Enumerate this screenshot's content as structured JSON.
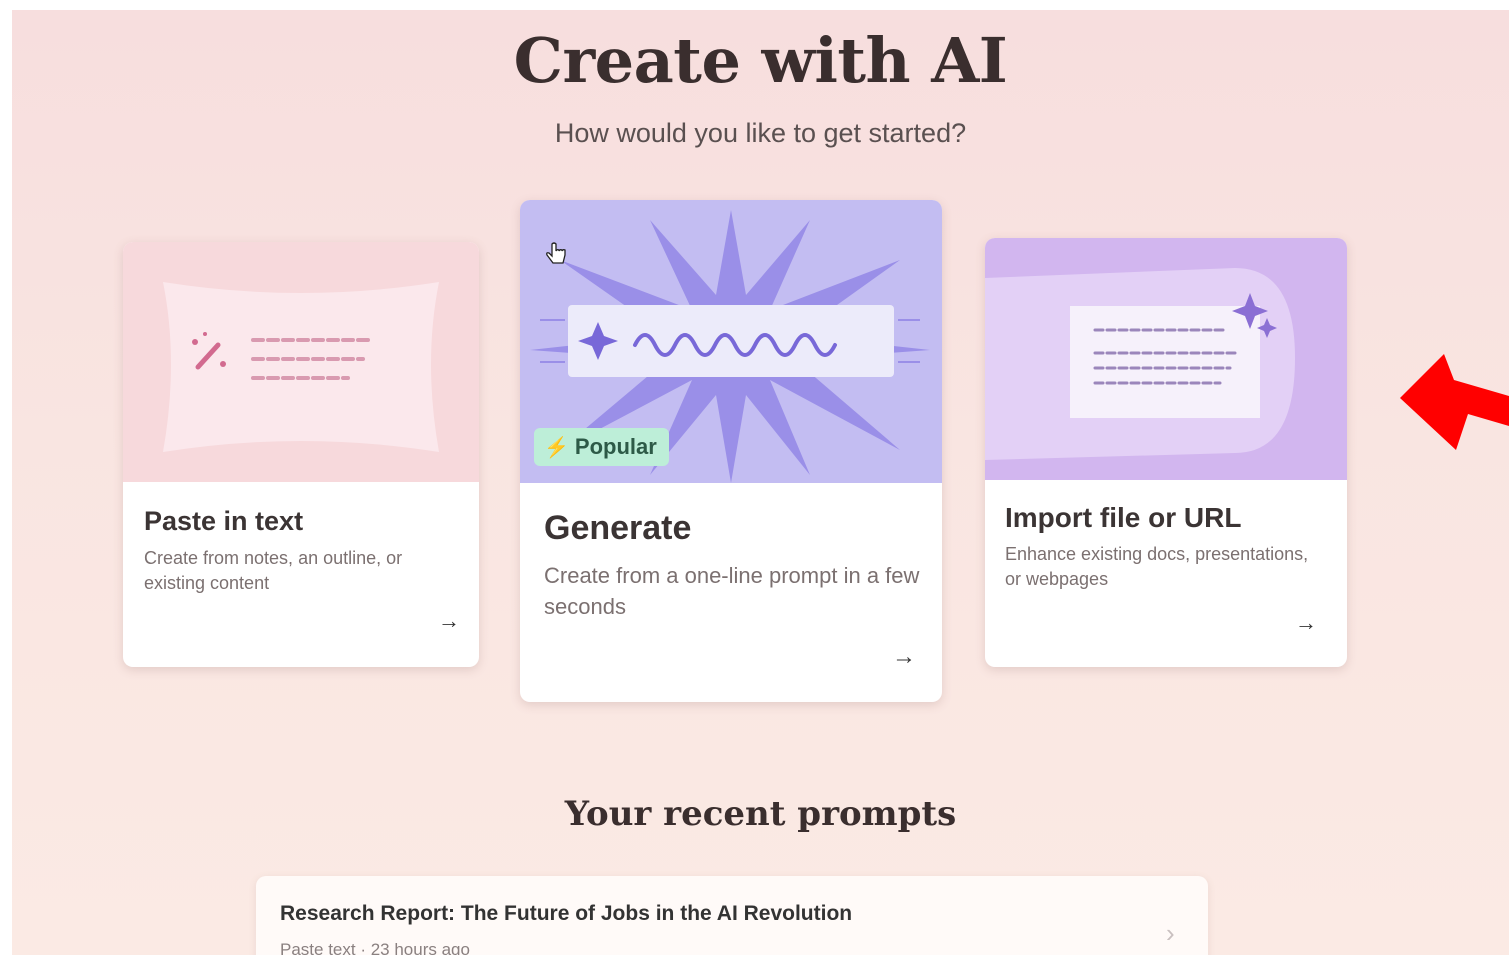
{
  "header": {
    "title": "Create with AI",
    "subtitle": "How would you like to get started?"
  },
  "cards": [
    {
      "title": "Paste in text",
      "description": "Create from notes, an outline, or existing content",
      "arrow": "→",
      "icon": "wand-text-icon"
    },
    {
      "title": "Generate",
      "description": "Create from a one-line prompt in a few seconds",
      "badge": "Popular",
      "arrow": "→",
      "icon": "sparkle-scribble-icon"
    },
    {
      "title": "Import file or URL",
      "description": "Enhance existing docs, presentations, or webpages",
      "arrow": "→",
      "icon": "document-sparkle-icon"
    }
  ],
  "recent": {
    "heading": "Your recent prompts",
    "items": [
      {
        "title": "Research Report: The Future of Jobs in the AI Revolution",
        "meta": "Paste text · 23 hours ago"
      }
    ]
  },
  "colors": {
    "background": "#f8e1df",
    "generate_art": "#c3bdf2",
    "import_art": "#d2b6ef",
    "paste_art": "#f7d9dc",
    "badge": "#bdeed8",
    "annotation_arrow": "#ff0000"
  }
}
